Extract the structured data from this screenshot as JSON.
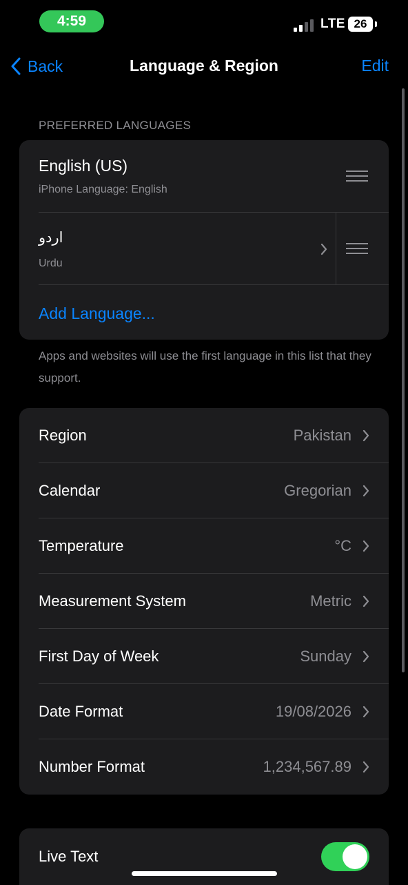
{
  "status": {
    "time": "4:59",
    "network": "LTE",
    "battery": "26"
  },
  "nav": {
    "back_label": "Back",
    "title": "Language & Region",
    "edit_label": "Edit"
  },
  "preferred_languages": {
    "header": "PREFERRED LANGUAGES",
    "languages": [
      {
        "title": "English (US)",
        "subtitle": "iPhone Language: English"
      },
      {
        "title": "اردو",
        "subtitle": "Urdu"
      }
    ],
    "add_label": "Add Language...",
    "footer": "Apps and websites will use the first language in this list that they support."
  },
  "region_settings": [
    {
      "label": "Region",
      "value": "Pakistan"
    },
    {
      "label": "Calendar",
      "value": "Gregorian"
    },
    {
      "label": "Temperature",
      "value": "°C"
    },
    {
      "label": "Measurement System",
      "value": "Metric"
    },
    {
      "label": "First Day of Week",
      "value": "Sunday"
    },
    {
      "label": "Date Format",
      "value": "19/08/2026"
    },
    {
      "label": "Number Format",
      "value": "1,234,567.89"
    }
  ],
  "live_text": {
    "label": "Live Text",
    "enabled": true
  },
  "colors": {
    "accent": "#0a84ff",
    "toggle_on": "#30d158",
    "time_pill": "#34c759"
  }
}
